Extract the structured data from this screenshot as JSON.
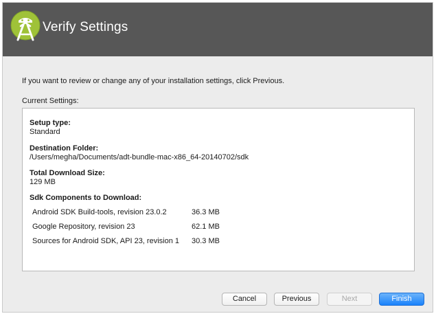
{
  "window": {
    "title": "Verify Settings"
  },
  "intro_text": "If you want to review or change any of your installation settings, click Previous.",
  "current_settings_label": "Current Settings:",
  "settings": {
    "setup_type": {
      "heading": "Setup type:",
      "value": "Standard"
    },
    "destination": {
      "heading": "Destination Folder:",
      "value": "/Users/megha/Documents/adt-bundle-mac-x86_64-20140702/sdk"
    },
    "download_size": {
      "heading": "Total Download Size:",
      "value": "129 MB"
    },
    "components": {
      "heading": "Sdk Components to Download:",
      "items": [
        {
          "name": "Android SDK Build-tools, revision 23.0.2",
          "size": "36.3 MB"
        },
        {
          "name": "Google Repository, revision 23",
          "size": "62.1 MB"
        },
        {
          "name": "Sources for Android SDK, API 23, revision 1",
          "size": "30.3 MB"
        }
      ]
    }
  },
  "buttons": {
    "cancel": "Cancel",
    "previous": "Previous",
    "next": "Next",
    "finish": "Finish"
  },
  "colors": {
    "header_bg": "#575757",
    "logo_green": "#9fc238",
    "finish_blue": "#1a82fb"
  },
  "icons": {
    "logo": "android-studio-logo-icon"
  }
}
